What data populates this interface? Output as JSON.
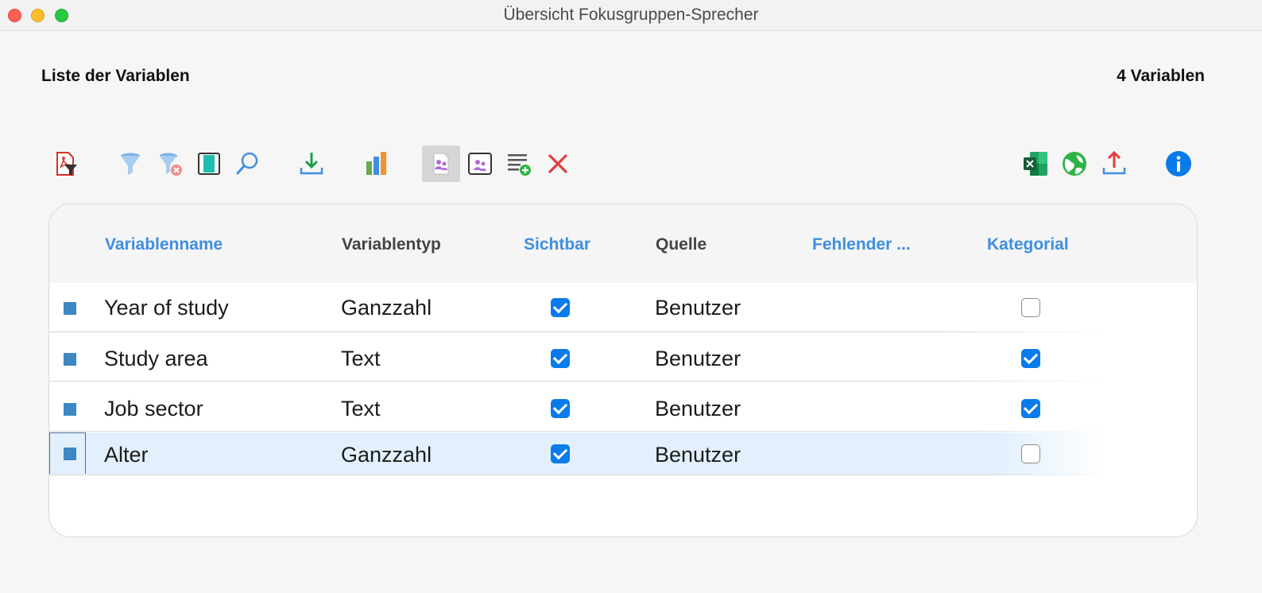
{
  "window": {
    "title": "Übersicht Fokusgruppen-Sprecher"
  },
  "header": {
    "list_title": "Liste der Variablen",
    "count_label": "4 Variablen"
  },
  "toolbar": {
    "icons": [
      "pdf-filter-icon",
      "filter-icon",
      "clear-filter-icon",
      "columns-icon",
      "search-icon",
      "import-icon",
      "chart-icon",
      "focus-group-speakers-icon",
      "focus-group-window-icon",
      "new-variable-icon",
      "delete-icon",
      "excel-export-icon",
      "web-export-icon",
      "export-icon",
      "info-icon"
    ],
    "active": "focus-group-speakers-icon"
  },
  "table": {
    "columns": [
      "Variablenname",
      "Variablentyp",
      "Sichtbar",
      "Quelle",
      "Fehlender ...",
      "Kategorial"
    ],
    "rows": [
      {
        "name": "Year of study",
        "type": "Ganzzahl",
        "visible": true,
        "source": "Benutzer",
        "missing": "",
        "categorical": false
      },
      {
        "name": "Study area",
        "type": "Text",
        "visible": true,
        "source": "Benutzer",
        "missing": "",
        "categorical": true
      },
      {
        "name": "Job sector",
        "type": "Text",
        "visible": true,
        "source": "Benutzer",
        "missing": "",
        "categorical": true
      },
      {
        "name": "Alter",
        "type": "Ganzzahl",
        "visible": true,
        "source": "Benutzer",
        "missing": "",
        "categorical": false
      }
    ],
    "selected_row": 3
  },
  "colors": {
    "accent": "#3f8ee0",
    "checkbox": "#0a7bea",
    "row_marker": "#3d87c2",
    "selection": "#e2f0fd"
  }
}
